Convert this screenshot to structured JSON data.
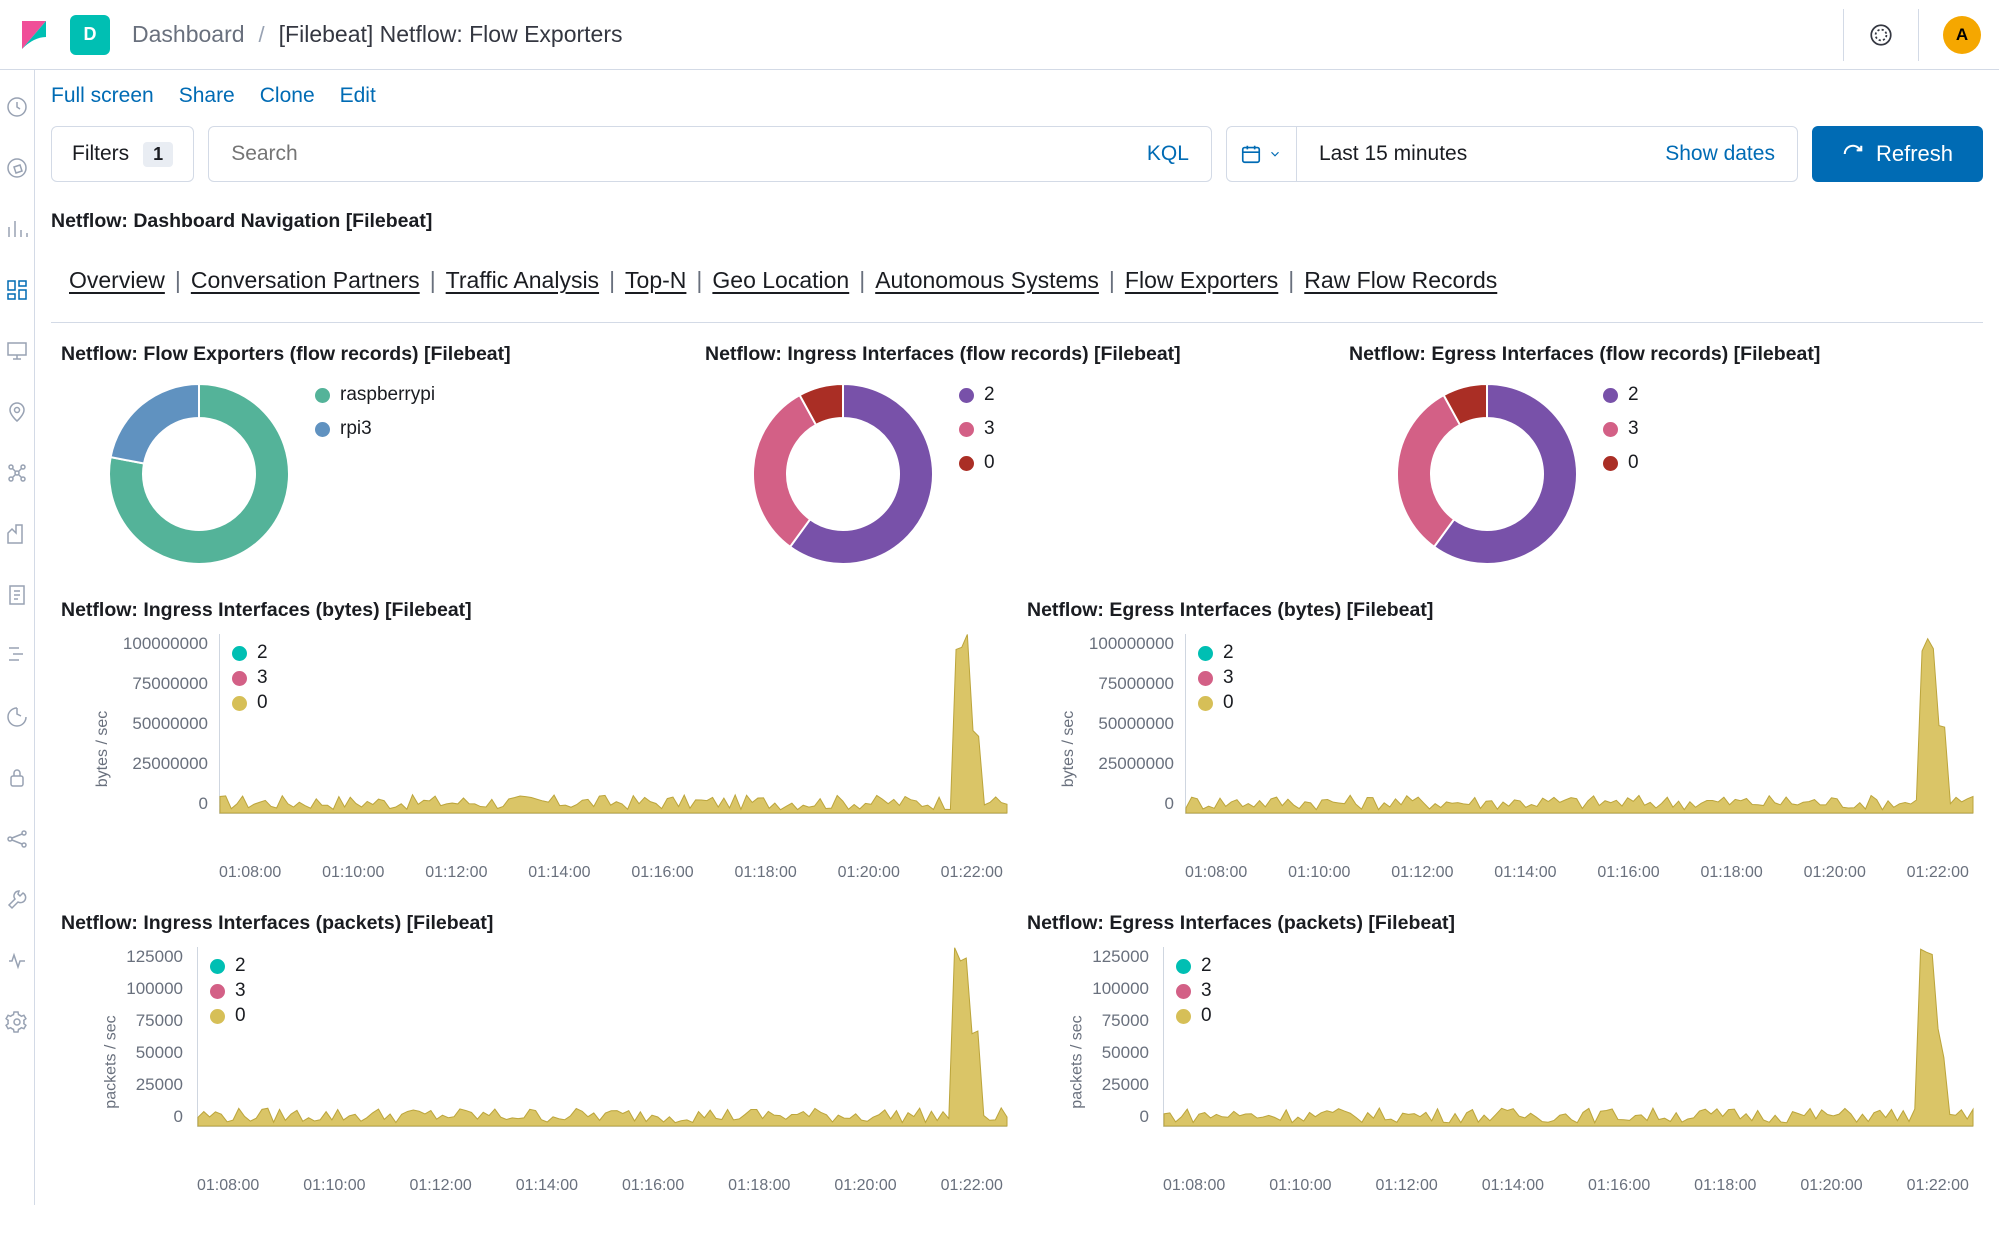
{
  "header": {
    "app_tile_letter": "D",
    "breadcrumb": {
      "root": "Dashboard",
      "current": "[Filebeat] Netflow: Flow Exporters"
    },
    "avatar_letter": "A"
  },
  "actions": {
    "full_screen": "Full screen",
    "share": "Share",
    "clone": "Clone",
    "edit": "Edit"
  },
  "filters": {
    "label": "Filters",
    "count": "1"
  },
  "search": {
    "placeholder": "Search",
    "kql_label": "KQL"
  },
  "date": {
    "range_text": "Last 15 minutes",
    "show_dates": "Show dates"
  },
  "refresh_label": "Refresh",
  "nav_panel": {
    "title": "Netflow: Dashboard Navigation [Filebeat]",
    "links": [
      "Overview",
      "Conversation Partners",
      "Traffic Analysis",
      "Top-N",
      "Geo Location",
      "Autonomous Systems",
      "Flow Exporters",
      "Raw Flow Records"
    ]
  },
  "donut_panels": [
    {
      "title": "Netflow: Flow Exporters (flow records) [Filebeat]",
      "legend": [
        {
          "label": "raspberrypi",
          "color": "#54b399"
        },
        {
          "label": "rpi3",
          "color": "#6092c0"
        }
      ]
    },
    {
      "title": "Netflow: Ingress Interfaces (flow records) [Filebeat]",
      "legend": [
        {
          "label": "2",
          "color": "#7851a9"
        },
        {
          "label": "3",
          "color": "#d36086"
        },
        {
          "label": "0",
          "color": "#aa2e25"
        }
      ]
    },
    {
      "title": "Netflow: Egress Interfaces (flow records) [Filebeat]",
      "legend": [
        {
          "label": "2",
          "color": "#7851a9"
        },
        {
          "label": "3",
          "color": "#d36086"
        },
        {
          "label": "0",
          "color": "#aa2e25"
        }
      ]
    }
  ],
  "line_panels": [
    {
      "title": "Netflow: Ingress Interfaces (bytes) [Filebeat]",
      "ylabel": "bytes / sec",
      "yticks": [
        "100000000",
        "75000000",
        "50000000",
        "25000000",
        "0"
      ],
      "xticks": [
        "01:08:00",
        "01:10:00",
        "01:12:00",
        "01:14:00",
        "01:16:00",
        "01:18:00",
        "01:20:00",
        "01:22:00"
      ],
      "legend": [
        {
          "label": "2",
          "color": "#00bfb3"
        },
        {
          "label": "3",
          "color": "#d36086"
        },
        {
          "label": "0",
          "color": "#d6bf57"
        }
      ]
    },
    {
      "title": "Netflow: Egress Interfaces (bytes) [Filebeat]",
      "ylabel": "bytes / sec",
      "yticks": [
        "100000000",
        "75000000",
        "50000000",
        "25000000",
        "0"
      ],
      "xticks": [
        "01:08:00",
        "01:10:00",
        "01:12:00",
        "01:14:00",
        "01:16:00",
        "01:18:00",
        "01:20:00",
        "01:22:00"
      ],
      "legend": [
        {
          "label": "2",
          "color": "#00bfb3"
        },
        {
          "label": "3",
          "color": "#d36086"
        },
        {
          "label": "0",
          "color": "#d6bf57"
        }
      ]
    },
    {
      "title": "Netflow: Ingress Interfaces (packets) [Filebeat]",
      "ylabel": "packets / sec",
      "yticks": [
        "125000",
        "100000",
        "75000",
        "50000",
        "25000",
        "0"
      ],
      "xticks": [
        "01:08:00",
        "01:10:00",
        "01:12:00",
        "01:14:00",
        "01:16:00",
        "01:18:00",
        "01:20:00",
        "01:22:00"
      ],
      "legend": [
        {
          "label": "2",
          "color": "#00bfb3"
        },
        {
          "label": "3",
          "color": "#d36086"
        },
        {
          "label": "0",
          "color": "#d6bf57"
        }
      ]
    },
    {
      "title": "Netflow: Egress Interfaces (packets) [Filebeat]",
      "ylabel": "packets / sec",
      "yticks": [
        "125000",
        "100000",
        "75000",
        "50000",
        "25000",
        "0"
      ],
      "xticks": [
        "01:08:00",
        "01:10:00",
        "01:12:00",
        "01:14:00",
        "01:16:00",
        "01:18:00",
        "01:20:00",
        "01:22:00"
      ],
      "legend": [
        {
          "label": "2",
          "color": "#00bfb3"
        },
        {
          "label": "3",
          "color": "#d36086"
        },
        {
          "label": "0",
          "color": "#d6bf57"
        }
      ]
    }
  ],
  "chart_data": [
    {
      "type": "pie",
      "title": "Netflow: Flow Exporters (flow records) [Filebeat]",
      "series": [
        {
          "name": "raspberrypi",
          "value": 78
        },
        {
          "name": "rpi3",
          "value": 22
        }
      ]
    },
    {
      "type": "pie",
      "title": "Netflow: Ingress Interfaces (flow records) [Filebeat]",
      "series": [
        {
          "name": "2",
          "value": 60
        },
        {
          "name": "3",
          "value": 32
        },
        {
          "name": "0",
          "value": 8
        }
      ]
    },
    {
      "type": "pie",
      "title": "Netflow: Egress Interfaces (flow records) [Filebeat]",
      "series": [
        {
          "name": "2",
          "value": 60
        },
        {
          "name": "3",
          "value": 32
        },
        {
          "name": "0",
          "value": 8
        }
      ]
    },
    {
      "type": "area",
      "title": "Netflow: Ingress Interfaces (bytes) [Filebeat]",
      "xlabel": "",
      "ylabel": "bytes / sec",
      "ylim": [
        0,
        100000000
      ],
      "x": [
        "01:08:00",
        "01:10:00",
        "01:12:00",
        "01:14:00",
        "01:16:00",
        "01:18:00",
        "01:20:00",
        "01:22:00"
      ],
      "series": [
        {
          "name": "2",
          "values": [
            2000000,
            4000000,
            3000000,
            5000000,
            2000000,
            4000000,
            3000000,
            5000000
          ]
        },
        {
          "name": "3",
          "values": [
            3000000,
            2000000,
            4000000,
            3000000,
            3000000,
            2000000,
            4000000,
            3000000
          ]
        },
        {
          "name": "0",
          "values": [
            5000000,
            6000000,
            8000000,
            5000000,
            4000000,
            6000000,
            10000000,
            95000000
          ]
        }
      ]
    },
    {
      "type": "area",
      "title": "Netflow: Egress Interfaces (bytes) [Filebeat]",
      "xlabel": "",
      "ylabel": "bytes / sec",
      "ylim": [
        0,
        100000000
      ],
      "x": [
        "01:08:00",
        "01:10:00",
        "01:12:00",
        "01:14:00",
        "01:16:00",
        "01:18:00",
        "01:20:00",
        "01:22:00"
      ],
      "series": [
        {
          "name": "2",
          "values": [
            2000000,
            4000000,
            3000000,
            5000000,
            2000000,
            4000000,
            3000000,
            5000000
          ]
        },
        {
          "name": "3",
          "values": [
            3000000,
            2000000,
            4000000,
            3000000,
            3000000,
            2000000,
            4000000,
            3000000
          ]
        },
        {
          "name": "0",
          "values": [
            5000000,
            6000000,
            8000000,
            5000000,
            4000000,
            6000000,
            10000000,
            95000000
          ]
        }
      ]
    },
    {
      "type": "area",
      "title": "Netflow: Ingress Interfaces (packets) [Filebeat]",
      "xlabel": "",
      "ylabel": "packets / sec",
      "ylim": [
        0,
        125000
      ],
      "x": [
        "01:08:00",
        "01:10:00",
        "01:12:00",
        "01:14:00",
        "01:16:00",
        "01:18:00",
        "01:20:00",
        "01:22:00"
      ],
      "series": [
        {
          "name": "2",
          "values": [
            3000,
            4000,
            3000,
            5000,
            2000,
            4000,
            3000,
            5000
          ]
        },
        {
          "name": "3",
          "values": [
            3000,
            2000,
            4000,
            3000,
            3000,
            2000,
            4000,
            3000
          ]
        },
        {
          "name": "0",
          "values": [
            5000,
            6000,
            8000,
            5000,
            4000,
            6000,
            10000,
            100000
          ]
        }
      ]
    },
    {
      "type": "area",
      "title": "Netflow: Egress Interfaces (packets) [Filebeat]",
      "xlabel": "",
      "ylabel": "packets / sec",
      "ylim": [
        0,
        125000
      ],
      "x": [
        "01:08:00",
        "01:10:00",
        "01:12:00",
        "01:14:00",
        "01:16:00",
        "01:18:00",
        "01:20:00",
        "01:22:00"
      ],
      "series": [
        {
          "name": "2",
          "values": [
            3000,
            4000,
            3000,
            5000,
            2000,
            4000,
            3000,
            5000
          ]
        },
        {
          "name": "3",
          "values": [
            3000,
            2000,
            4000,
            3000,
            3000,
            2000,
            4000,
            3000
          ]
        },
        {
          "name": "0",
          "values": [
            5000,
            6000,
            8000,
            5000,
            4000,
            6000,
            10000,
            100000
          ]
        }
      ]
    }
  ]
}
